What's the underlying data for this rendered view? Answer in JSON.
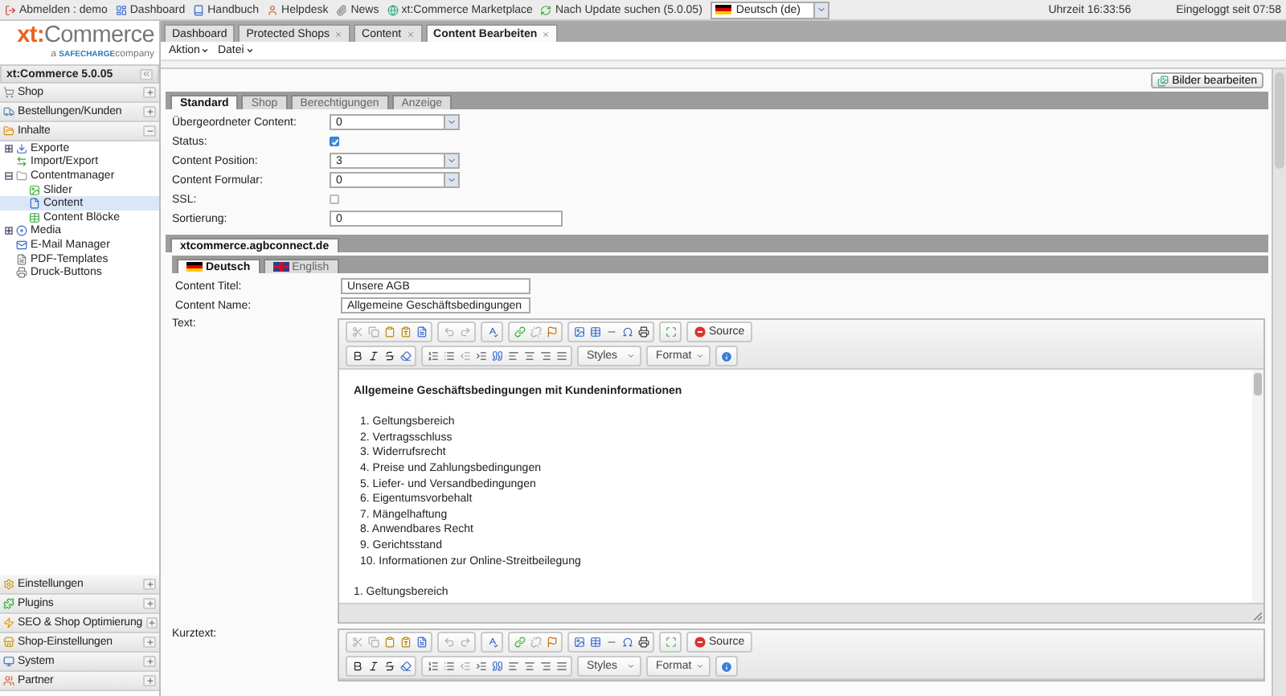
{
  "topbar": {
    "links": [
      {
        "label": "Abmelden : demo"
      },
      {
        "label": "Dashboard"
      },
      {
        "label": "Handbuch"
      },
      {
        "label": "Helpdesk"
      },
      {
        "label": "News"
      },
      {
        "label": "xt:Commerce Marketplace"
      },
      {
        "label": "Nach Update suchen (5.0.05)"
      }
    ],
    "language": "Deutsch (de)",
    "time": "Uhrzeit 16:33:56",
    "login": "Eingeloggt seit 07:58"
  },
  "logo": {
    "prefix": "xt:",
    "brand": "Commerce",
    "tagline_start": "a",
    "tagline_brand": "SAFECHARGE",
    "tagline_end": "company"
  },
  "sidebar": {
    "title": "xt:Commerce 5.0.05",
    "sections": [
      {
        "label": "Shop",
        "expanded": false
      },
      {
        "label": "Bestellungen/Kunden",
        "expanded": false
      },
      {
        "label": "Inhalte",
        "expanded": true,
        "children": [
          {
            "label": "Exporte",
            "expanded": false,
            "selected": false
          },
          {
            "label": "Import/Export",
            "selected": false
          },
          {
            "label": "Contentmanager",
            "expanded": true,
            "selected": false,
            "children": [
              {
                "label": "Slider",
                "selected": false
              },
              {
                "label": "Content",
                "selected": true
              },
              {
                "label": "Content Blöcke",
                "selected": false
              }
            ]
          },
          {
            "label": "Media",
            "expanded": false,
            "selected": false
          },
          {
            "label": "E-Mail Manager",
            "selected": false
          },
          {
            "label": "PDF-Templates",
            "selected": false
          },
          {
            "label": "Druck-Buttons",
            "selected": false
          }
        ]
      }
    ],
    "bottom_sections": [
      {
        "label": "Einstellungen",
        "expanded": false
      },
      {
        "label": "Plugins",
        "expanded": false
      },
      {
        "label": "SEO & Shop Optimierung",
        "expanded": false
      },
      {
        "label": "Shop-Einstellungen",
        "expanded": false
      },
      {
        "label": "System",
        "expanded": false
      },
      {
        "label": "Partner",
        "expanded": false
      }
    ]
  },
  "tabs": [
    {
      "label": "Dashboard",
      "closable": false,
      "selected": false
    },
    {
      "label": "Protected Shops",
      "closable": true,
      "selected": false
    },
    {
      "label": "Content",
      "closable": true,
      "selected": false
    },
    {
      "label": "Content Bearbeiten",
      "closable": true,
      "selected": true
    }
  ],
  "menus": [
    {
      "label": "Aktion"
    },
    {
      "label": "Datei"
    }
  ],
  "image_button": "Bilder bearbeiten",
  "form_tabs": [
    {
      "label": "Standard",
      "selected": true
    },
    {
      "label": "Shop",
      "selected": false
    },
    {
      "label": "Berechtigungen",
      "selected": false
    },
    {
      "label": "Anzeige",
      "selected": false
    }
  ],
  "fields": [
    {
      "kind": "select",
      "label": "Übergeordneter Content:",
      "value": "0"
    },
    {
      "kind": "checkbox",
      "label": "Status:",
      "checked": true
    },
    {
      "kind": "select",
      "label": "Content Position:",
      "value": "3"
    },
    {
      "kind": "select",
      "label": "Content Formular:",
      "value": "0"
    },
    {
      "kind": "checkbox",
      "label": "SSL:",
      "checked": false
    },
    {
      "kind": "text",
      "label": "Sortierung:",
      "value": "0"
    }
  ],
  "store_tabs": [
    {
      "label": "xtcommerce.agbconnect.de",
      "selected": true
    }
  ],
  "language_tabs": [
    {
      "label": "Deutsch",
      "selected": true
    },
    {
      "label": "English",
      "selected": false
    }
  ],
  "language_fields": [
    {
      "label": "Content Titel:",
      "value": "Unsere AGB"
    },
    {
      "label": "Content Name:",
      "value": "Allgemeine Geschäftsbedingungen"
    }
  ],
  "editors": [
    {
      "label": "Text:",
      "source": "Source",
      "styles": "Styles",
      "format": "Format",
      "heading": "Allgemeine Geschäftsbedingungen mit Kundeninformationen",
      "items": [
        "1. Geltungsbereich",
        "2. Vertragsschluss",
        "3. Widerrufsrecht",
        "4. Preise und Zahlungsbedingungen",
        "5. Liefer-  und Versandbedingungen",
        "6. Eigentumsvorbehalt",
        "7. Mängelhaftung",
        "8. Anwendbares Recht",
        "9. Gerichtsstand",
        "10. Informationen zur Online-Streitbeilegung"
      ],
      "after": "1. Geltungsbereich"
    },
    {
      "label": "Kurztext:",
      "source": "Source",
      "styles": "Styles",
      "format": "Format"
    }
  ]
}
